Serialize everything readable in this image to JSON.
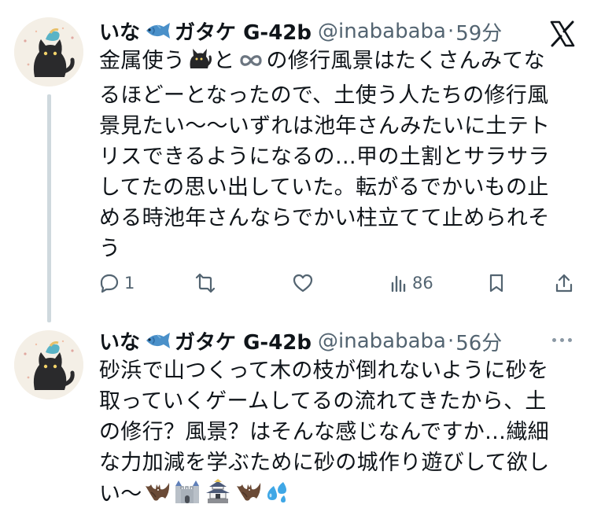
{
  "posts": [
    {
      "author": {
        "display_name_prefix": "いな",
        "display_name_suffix": "ガタケ G-42b",
        "handle": "@inabababa",
        "separator": "·",
        "time": "59分"
      },
      "header_icon": "x-logo-icon",
      "lines": [
        [
          "金属使う",
          "{cat}",
          "と",
          "{infinity}",
          "の修行風景はたくさんみてな"
        ],
        [
          "るほどーとなったので、土使う人たちの修行風"
        ],
        [
          "景見たい〜〜いずれは池年さんみたいに土テト"
        ],
        [
          "リスできるようになるの…甲の土割とサラサラ"
        ],
        [
          "してたの思い出していた。転がるでかいもの止"
        ],
        [
          "める時池年さんならでかい柱立てて止められそ"
        ],
        [
          "う"
        ]
      ],
      "actions": {
        "reply_count": "1",
        "repost_count": "",
        "like_count": "",
        "view_count": "86"
      }
    },
    {
      "author": {
        "display_name_prefix": "いな",
        "display_name_suffix": "ガタケ G-42b",
        "handle": "@inabababa",
        "separator": "·",
        "time": "56分"
      },
      "header_icon": "more-icon",
      "lines": [
        [
          "砂浜で山つくって木の枝が倒れないように砂を"
        ],
        [
          "取っていくゲームしてるの流れてきたから、土"
        ],
        [
          "の修行？風景？はそんな感じなんですか…繊細"
        ],
        [
          "な力加減を学ぶために砂の城作り遊びして欲し"
        ],
        [
          "い〜",
          "{bat}",
          "{castle}",
          "{japanese-castle}",
          "{bat}",
          "{sweat-drops}"
        ]
      ]
    }
  ],
  "icons": {
    "reply": "reply-icon",
    "repost": "repost-icon",
    "like": "like-icon",
    "views": "views-icon",
    "bookmark": "bookmark-icon",
    "share": "share-icon",
    "fish": "fish-emoji-icon",
    "avatar": "black-cat-avatar"
  },
  "colors": {
    "text": "#0f1419",
    "secondary": "#536471",
    "thread_line": "#cfd9de",
    "fish": "#4a90c9"
  }
}
